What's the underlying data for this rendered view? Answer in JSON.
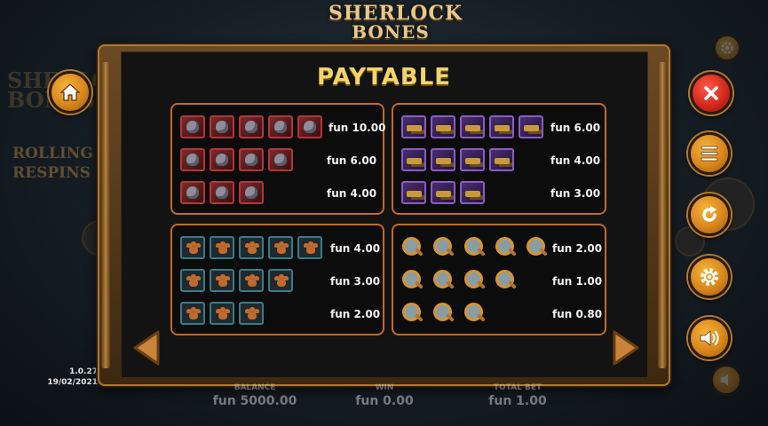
{
  "logo": {
    "line1": "SHERLOCK",
    "line2": "BONES"
  },
  "background": {
    "logo_faded": "SHERLOCK BONES",
    "feature_label_1": "ROLLING",
    "feature_label_2": "RESPINS"
  },
  "version": {
    "number": "1.0.27",
    "date": "19/02/2021"
  },
  "paytable": {
    "title": "PAYTABLE",
    "panels": [
      {
        "symbol": "cat-icon",
        "border_color": "#b3363a",
        "rows": [
          {
            "count": 5,
            "payout": "fun 10.00"
          },
          {
            "count": 4,
            "payout": "fun 6.00"
          },
          {
            "count": 3,
            "payout": "fun 4.00"
          }
        ]
      },
      {
        "symbol": "pistol-icon",
        "border_color": "#8a5cc4",
        "rows": [
          {
            "count": 5,
            "payout": "fun 6.00"
          },
          {
            "count": 4,
            "payout": "fun 4.00"
          },
          {
            "count": 3,
            "payout": "fun 3.00"
          }
        ]
      },
      {
        "symbol": "paw-icon",
        "border_color": "#3a7a88",
        "rows": [
          {
            "count": 5,
            "payout": "fun 4.00"
          },
          {
            "count": 4,
            "payout": "fun 3.00"
          },
          {
            "count": 3,
            "payout": "fun 2.00"
          }
        ]
      },
      {
        "symbol": "magnifying-glass-icon",
        "border_color": "#d69530",
        "rows": [
          {
            "count": 5,
            "payout": "fun 2.00"
          },
          {
            "count": 4,
            "payout": "fun 1.00"
          },
          {
            "count": 3,
            "payout": "fun 0.80"
          }
        ]
      }
    ]
  },
  "nav": {
    "prev_icon": "arrow-left-icon",
    "next_icon": "arrow-right-icon"
  },
  "side_buttons": {
    "home_icon": "home-icon",
    "close_icon": "close-icon",
    "menu_icon": "menu-icon",
    "replay_icon": "replay-icon",
    "settings_icon": "settings-icon",
    "sound_icon": "sound-icon"
  },
  "stats": {
    "balance_label": "BALANCE",
    "balance_value": "fun 5000.00",
    "win_label": "WIN",
    "win_value": "fun 0.00",
    "total_bet_label": "TOTAL BET",
    "total_bet_value": "fun 1.00"
  },
  "colors": {
    "accent_gold": "#f3d46a",
    "panel_border": "#c56a25",
    "button_orange": "#d9861c",
    "close_red": "#d42a1c"
  }
}
